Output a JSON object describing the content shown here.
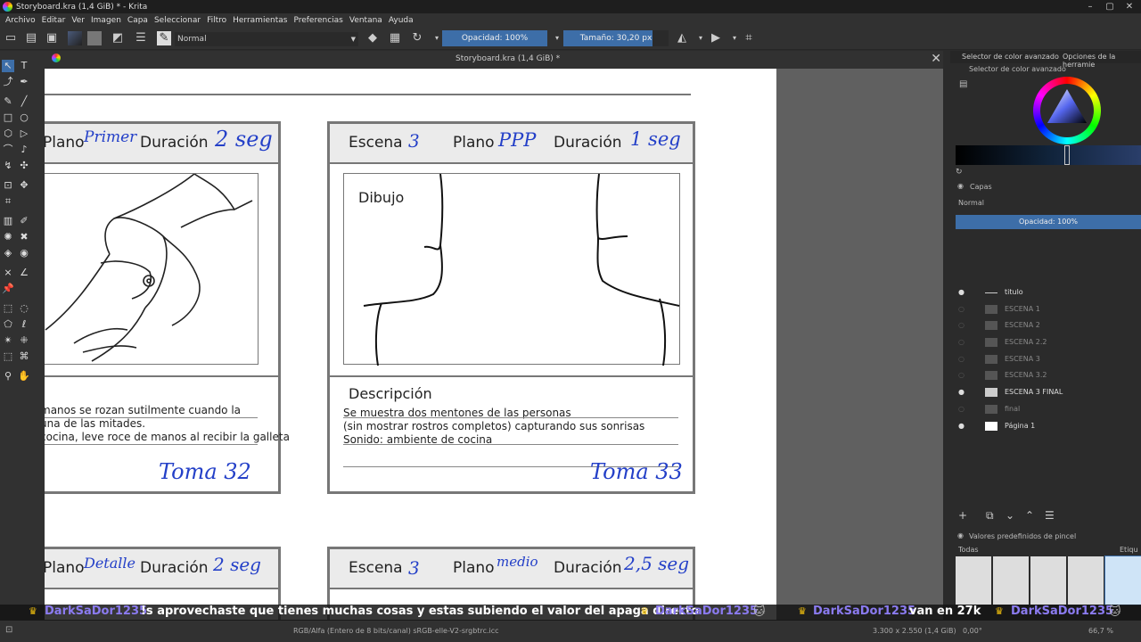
{
  "window": {
    "title": "Storyboard.kra (1,4 GiB) * - Krita"
  },
  "menu": [
    "Archivo",
    "Editar",
    "Ver",
    "Imagen",
    "Capa",
    "Seleccionar",
    "Filtro",
    "Herramientas",
    "Preferencias",
    "Ventana",
    "Ayuda"
  ],
  "toolbar": {
    "blend_mode": "Normal",
    "opacity_label": "Opacidad: 100%",
    "size_label": "Tamaño: 30,20 px"
  },
  "document": {
    "tab_title": "Storyboard.kra (1,4 GiB) *"
  },
  "storyboard": {
    "panel1": {
      "plano_label": "Plano",
      "plano_value": "Primer",
      "duracion_label": "Duración",
      "duracion_value": "2 seg",
      "desc_lines": [
        "manos se rozan sutilmente cuando la",
        "una de las mitades.",
        "cocina, leve roce de manos al recibir la galleta"
      ],
      "toma": "Toma 32"
    },
    "panel2": {
      "escena_label": "Escena",
      "escena_value": "3",
      "plano_label": "Plano",
      "plano_value": "PPP",
      "duracion_label": "Duración",
      "duracion_value": "1 seg",
      "dibujo_label": "Dibujo",
      "desc_title": "Descripción",
      "desc_lines": [
        "Se muestra dos mentones de las personas",
        "(sin mostrar rostros completos) capturando sus sonrisas",
        "Sonido: ambiente de cocina"
      ],
      "toma": "Toma 33"
    },
    "panel3": {
      "plano_label": "Plano",
      "plano_value": "Detalle",
      "duracion_label": "Duración",
      "duracion_value": "2 seg"
    },
    "panel4": {
      "escena_label": "Escena",
      "escena_value": "3",
      "plano_label": "Plano",
      "plano_value": "medio",
      "duracion_label": "Duración",
      "duracion_value": "2,5 seg"
    }
  },
  "dock": {
    "tab1": "Selector de color avanzado",
    "tab2": "Opciones de la herramie",
    "color_selector_title": "Selector de color avanzado",
    "layers_title": "Capas",
    "layers_blend": "Normal",
    "layers_opacity": "Opacidad:  100%",
    "layers": [
      {
        "name": "titulo",
        "visible": true
      },
      {
        "name": "ESCENA 1",
        "visible": false
      },
      {
        "name": "ESCENA 2",
        "visible": false
      },
      {
        "name": "ESCENA 2.2",
        "visible": false
      },
      {
        "name": "ESCENA 3",
        "visible": false
      },
      {
        "name": "ESCENA 3.2",
        "visible": false
      },
      {
        "name": "ESCENA 3 FINAL",
        "visible": true
      },
      {
        "name": "final",
        "visible": false
      },
      {
        "name": "Página 1",
        "visible": true
      }
    ],
    "presets_title": "Valores predefinidos de pincel",
    "presets_filter": "Todas",
    "presets_tag": "Etiqu"
  },
  "status": {
    "color_space": "RGB/Alfa (Entero de 8 bits/canal)  sRGB-elle-V2-srgbtrc.icc",
    "dimensions": "3.300 x 2.550 (1,4 GiB)",
    "rotation": "0,00°",
    "zoom": "66,7 %"
  },
  "chat": [
    {
      "nick": "DarkSaDor1235",
      "msg": "!s aprovechaste que tienes muchas cosas y estas subiendo el valor del apaga directo"
    },
    {
      "nick": "DarkSaDor1235",
      "msg": ""
    },
    {
      "nick": "DarkSaDor1235",
      "msg": "van en 27k"
    },
    {
      "nick": "DarkSaDor1235",
      "msg": ""
    }
  ]
}
